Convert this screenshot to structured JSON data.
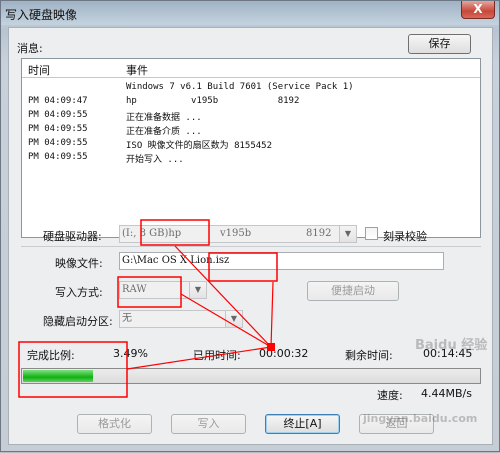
{
  "window": {
    "title": "写入硬盘映像",
    "close_glyph": "X"
  },
  "messages": {
    "label": "消息:",
    "save_button": "保存",
    "columns": [
      "时间",
      "事件"
    ],
    "rows": [
      {
        "time": "",
        "event": "Windows 7 v6.1 Build 7601 (Service Pack 1)"
      },
      {
        "time": "PM 04:09:47",
        "event": "hp          v195b           8192"
      },
      {
        "time": "PM 04:09:55",
        "event": "正在准备数据 ..."
      },
      {
        "time": "PM 04:09:55",
        "event": "正在准备介质 ..."
      },
      {
        "time": "PM 04:09:55",
        "event": "ISO 映像文件的扇区数为 8155452"
      },
      {
        "time": "PM 04:09:55",
        "event": "开始写入 ..."
      }
    ]
  },
  "form": {
    "drive_label": "硬盘驱动器:",
    "drive_value": "(I:, 8 GB)hp",
    "drive_rev": "v195b",
    "drive_size": "8192",
    "verify_label": "刻录校验",
    "image_label": "映像文件:",
    "image_value": "G:\\Mac OS X Lion.isz",
    "method_label": "写入方式:",
    "method_value": "RAW",
    "quick_boot_button": "便捷启动",
    "hidden_partition_label": "隐藏启动分区:",
    "hidden_partition_value": "无"
  },
  "progress": {
    "complete_label": "完成比例:",
    "complete_value": "3.49%",
    "fraction": 0.0349,
    "elapsed_label": "已用时间:",
    "elapsed_value": "00:00:32",
    "remaining_label": "剩余时间:",
    "remaining_value": "00:14:45",
    "speed_label": "速度:",
    "speed_value": "4.44MB/s"
  },
  "buttons": {
    "format": "格式化",
    "write": "写入",
    "stop": "终止[A]",
    "back": "返回"
  },
  "watermarks": {
    "top": "Baidu 经验",
    "bottom": "jingyan.baidu.com"
  },
  "colors": {
    "annotation": "#ff0000",
    "progress_green": "#12b012"
  }
}
